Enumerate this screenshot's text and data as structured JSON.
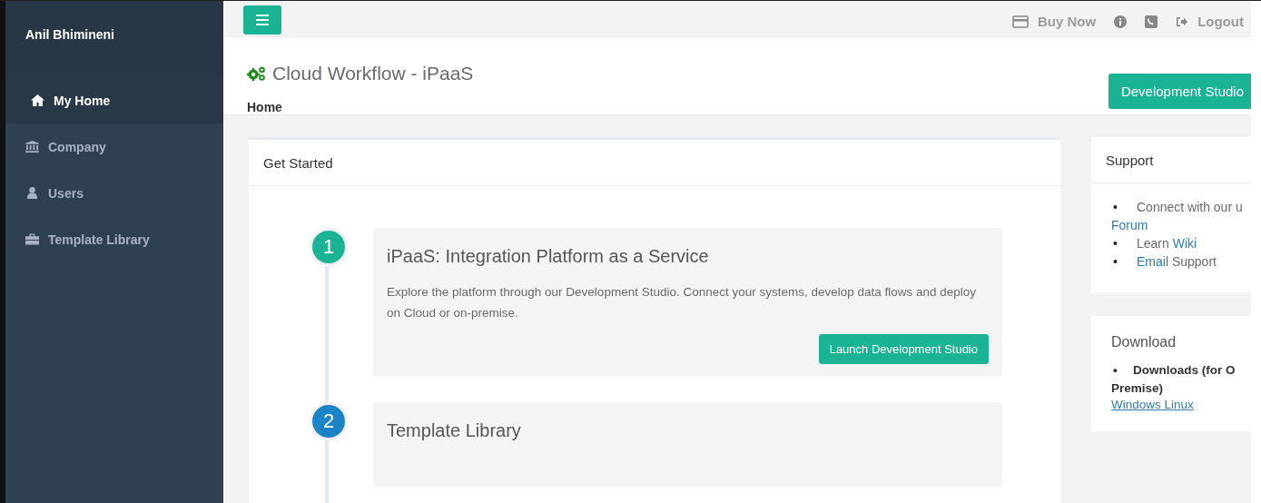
{
  "sidebar": {
    "user_name": "Anil Bhimineni",
    "items": [
      {
        "label": "My Home",
        "selected": true
      },
      {
        "label": "Company",
        "selected": false
      },
      {
        "label": "Users",
        "selected": false
      },
      {
        "label": "Template Library",
        "selected": false
      }
    ]
  },
  "top_bar": {
    "buy_now": "Buy Now",
    "logout": "Logout"
  },
  "header": {
    "title": "Cloud Workflow - iPaaS",
    "breadcrumb": "Home",
    "button": "Development Studio"
  },
  "get_started": {
    "title": "Get Started",
    "steps": [
      {
        "number": "1",
        "color": "#1ab394",
        "title": "iPaaS: Integration Platform as a Service",
        "text": "Explore the platform through our Development Studio. Connect your systems, develop data flows and deploy on Cloud or on-premise.",
        "button": "Launch Development Studio"
      },
      {
        "number": "2",
        "color": "#1c84c6",
        "title": "Template Library"
      }
    ]
  },
  "support": {
    "title": "Support",
    "items": [
      {
        "bullet": "•",
        "parts": [
          {
            "kind": "text",
            "text": "Connect with our u"
          },
          {
            "kind": "link",
            "text": "Forum"
          }
        ]
      },
      {
        "bullet": "•",
        "parts": [
          {
            "kind": "text",
            "text": "Learn"
          },
          {
            "kind": "link",
            "text": "Wiki"
          }
        ]
      },
      {
        "bullet": "•",
        "parts": [
          {
            "kind": "link",
            "text": "Email"
          },
          {
            "kind": "text",
            "text": "Support"
          }
        ]
      }
    ]
  },
  "download": {
    "title": "Download",
    "bullet": "•",
    "item": "Downloads (for O Premise)",
    "link": "Windows Linux"
  }
}
